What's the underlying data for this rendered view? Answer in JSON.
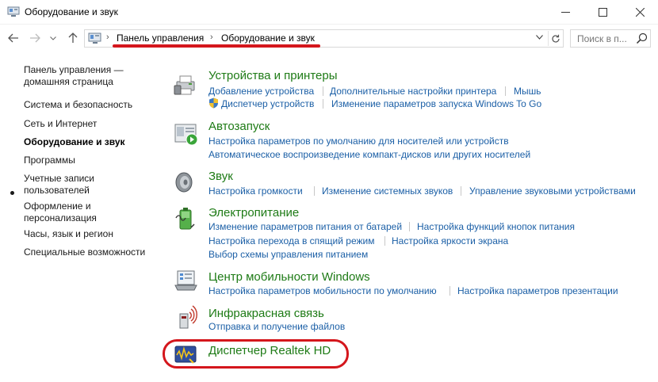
{
  "window": {
    "title": "Оборудование и звук"
  },
  "address": {
    "crumbs": [
      "Панель управления",
      "Оборудование и звук"
    ],
    "search_placeholder": "Поиск в п..."
  },
  "nav": {
    "items": [
      "Панель управления — домашняя страница",
      "Система и безопасность",
      "Сеть и Интернет",
      "Оборудование и звук",
      "Программы",
      "Учетные записи пользователей",
      "Оформление и персонализация",
      "Часы, язык и регион",
      "Специальные возможности"
    ],
    "active_index": 3
  },
  "sections": [
    {
      "title": "Устройства и принтеры",
      "icon": "printer-icon",
      "rows": [
        [
          "Добавление устройства",
          "Дополнительные настройки принтера",
          "Мышь"
        ],
        [
          "Диспетчер устройств",
          "Изменение параметров запуска Windows To Go"
        ]
      ]
    },
    {
      "title": "Автозапуск",
      "icon": "autoplay-icon",
      "rows": [
        [
          "Настройка параметров по умолчанию для носителей или устройств"
        ],
        [
          "Автоматическое воспроизведение компакт-дисков или других носителей"
        ]
      ]
    },
    {
      "title": "Звук",
      "icon": "speaker-icon",
      "rows": [
        [
          "Настройка громкости",
          "Изменение системных звуков",
          "Управление звуковыми устройствами"
        ]
      ]
    },
    {
      "title": "Электропитание",
      "icon": "battery-icon",
      "rows": [
        [
          "Изменение параметров питания от батарей",
          "Настройка функций кнопок питания"
        ],
        [
          "Настройка перехода в спящий режим",
          "Настройка яркости экрана"
        ],
        [
          "Выбор схемы управления питанием"
        ]
      ]
    },
    {
      "title": "Центр мобильности Windows",
      "icon": "mobility-center-icon",
      "rows": [
        [
          "Настройка параметров мобильности по умолчанию",
          "Настройка параметров презентации"
        ]
      ]
    },
    {
      "title": "Инфракрасная связь",
      "icon": "infrared-icon",
      "rows": [
        [
          "Отправка и получение файлов"
        ]
      ]
    },
    {
      "title": "Диспетчер Realtek HD",
      "icon": "realtek-icon",
      "rows": []
    }
  ],
  "colors": {
    "link": "#1b5fa6",
    "section_title": "#1e7b16",
    "highlight": "#d4161c"
  }
}
